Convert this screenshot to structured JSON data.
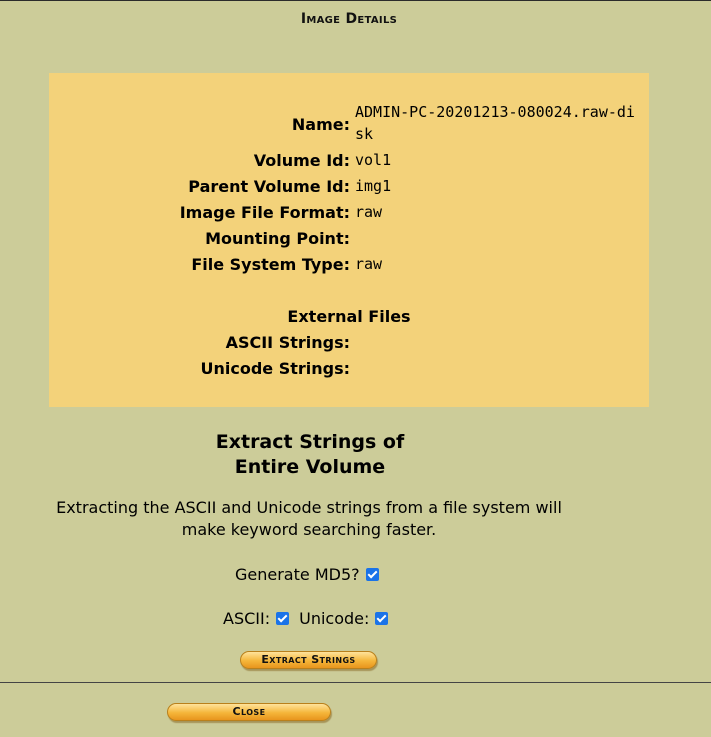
{
  "page_title": "Image Details",
  "details": {
    "name_label": "Name:",
    "name_value": "ADMIN-PC-20201213-080024.raw-disk",
    "volume_id_label": "Volume Id:",
    "volume_id_value": "vol1",
    "parent_volume_id_label": "Parent Volume Id:",
    "parent_volume_id_value": "img1",
    "image_file_format_label": "Image File Format:",
    "image_file_format_value": "raw",
    "mounting_point_label": "Mounting Point:",
    "mounting_point_value": "",
    "file_system_type_label": "File System Type:",
    "file_system_type_value": "raw",
    "external_files_heading": "External Files",
    "ascii_strings_label": "ASCII Strings:",
    "ascii_strings_value": "",
    "unicode_strings_label": "Unicode Strings:",
    "unicode_strings_value": ""
  },
  "extract": {
    "title_line1": "Extract Strings of",
    "title_line2": "Entire Volume",
    "description_line1": "Extracting the ASCII and Unicode strings from a file system will",
    "description_line2": "make keyword searching faster.",
    "generate_md5_label": "Generate MD5?",
    "generate_md5_checked": true,
    "ascii_label": "ASCII:",
    "ascii_checked": true,
    "unicode_label": "Unicode:",
    "unicode_checked": true,
    "extract_button_label": "Extract Strings"
  },
  "footer": {
    "close_button_label": "Close"
  },
  "colors": {
    "page_background": "#cccc99",
    "panel_background": "#f3d27a",
    "button_orange": "#f5b63a",
    "checkbox_blue": "#1a73e8"
  }
}
